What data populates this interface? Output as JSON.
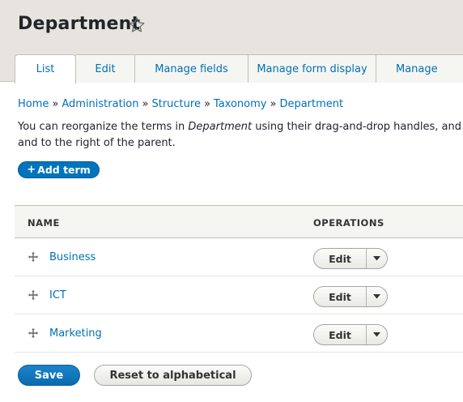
{
  "header": {
    "title": "Department",
    "star_icon": "star-outline-icon"
  },
  "tabs": [
    {
      "label": "List",
      "active": true
    },
    {
      "label": "Edit",
      "active": false
    },
    {
      "label": "Manage fields",
      "active": false
    },
    {
      "label": "Manage form display",
      "active": false
    },
    {
      "label": "Manage",
      "active": false
    }
  ],
  "breadcrumb": {
    "items": [
      "Home",
      "Administration",
      "Structure",
      "Taxonomy",
      "Department"
    ],
    "separator": "»"
  },
  "help": {
    "line1_before": "You can reorganize the terms in ",
    "line1_em": "Department",
    "line1_after": " using their drag-and-drop handles, and g",
    "line2": "and to the right of the parent."
  },
  "add_term": {
    "plus": "+",
    "label": "Add term"
  },
  "table": {
    "headers": {
      "name": "NAME",
      "operations": "OPERATIONS"
    },
    "rows": [
      {
        "name": "Business",
        "op_label": "Edit"
      },
      {
        "name": "ICT",
        "op_label": "Edit"
      },
      {
        "name": "Marketing",
        "op_label": "Edit"
      }
    ]
  },
  "actions": {
    "save": "Save",
    "reset": "Reset to alphabetical"
  },
  "colors": {
    "link": "#0071b8",
    "primary": "#0074bd",
    "header_bg": "#e7e4df"
  }
}
